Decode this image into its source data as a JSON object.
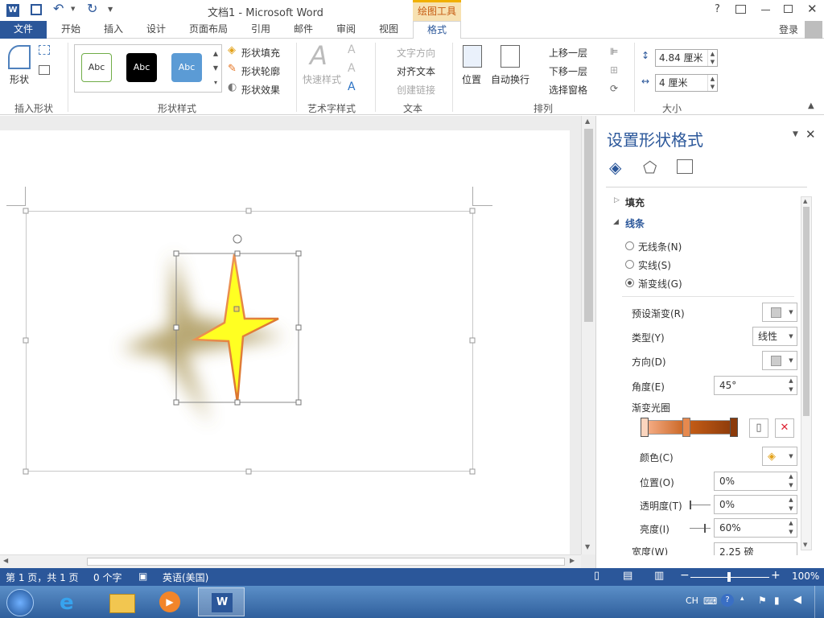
{
  "title": {
    "doc": "文档1 - Microsoft Word",
    "context_tab": "绘图工具",
    "help": "?"
  },
  "tabs": [
    "文件",
    "开始",
    "插入",
    "设计",
    "页面布局",
    "引用",
    "邮件",
    "审阅",
    "视图",
    "格式"
  ],
  "login": "登录",
  "ribbon": {
    "insert_shape": {
      "shapes_label": "形状",
      "group": "插入形状"
    },
    "shape_styles": {
      "samples": [
        "Abc",
        "Abc",
        "Abc"
      ],
      "fill": "形状填充",
      "outline": "形状轮廓",
      "effects": "形状效果",
      "group": "形状样式"
    },
    "wordart": {
      "quick_styles": "快速样式",
      "group": "艺术字样式"
    },
    "text": {
      "direction": "文字方向",
      "align": "对齐文本",
      "link": "创建链接",
      "group": "文本"
    },
    "arrange": {
      "position": "位置",
      "wrap": "自动换行",
      "bring_forward": "上移一层",
      "send_backward": "下移一层",
      "selection_pane": "选择窗格",
      "group": "排列"
    },
    "size": {
      "height": "4.84 厘米",
      "width": "4 厘米",
      "group": "大小"
    }
  },
  "pane": {
    "title": "设置形状格式",
    "fill_section": "填充",
    "line_section": "线条",
    "radios": [
      "无线条(N)",
      "实线(S)",
      "渐变线(G)"
    ],
    "preset_label": "预设渐变(R)",
    "type_label": "类型(Y)",
    "type_value": "线性",
    "direction_label": "方向(D)",
    "angle_label": "角度(E)",
    "angle_value": "45°",
    "stops_label": "渐变光圈",
    "color_label": "颜色(C)",
    "position_label": "位置(O)",
    "position_value": "0%",
    "transparency_label": "透明度(T)",
    "transparency_value": "0%",
    "brightness_label": "亮度(I)",
    "brightness_value": "60%",
    "width_label": "宽度(W)",
    "width_value": "2.25 磅"
  },
  "status": {
    "page": "第 1 页，共 1 页",
    "words": "0 个字",
    "lang": "英语(美国)",
    "zoom": "100%",
    "zoom_level": 1.0
  },
  "taskbar": {
    "ime": "CH"
  },
  "colors": {
    "accent": "#2b579a",
    "context": "#f0b000",
    "star_fill": "#ffff22",
    "star_outline": "#e5731f"
  }
}
